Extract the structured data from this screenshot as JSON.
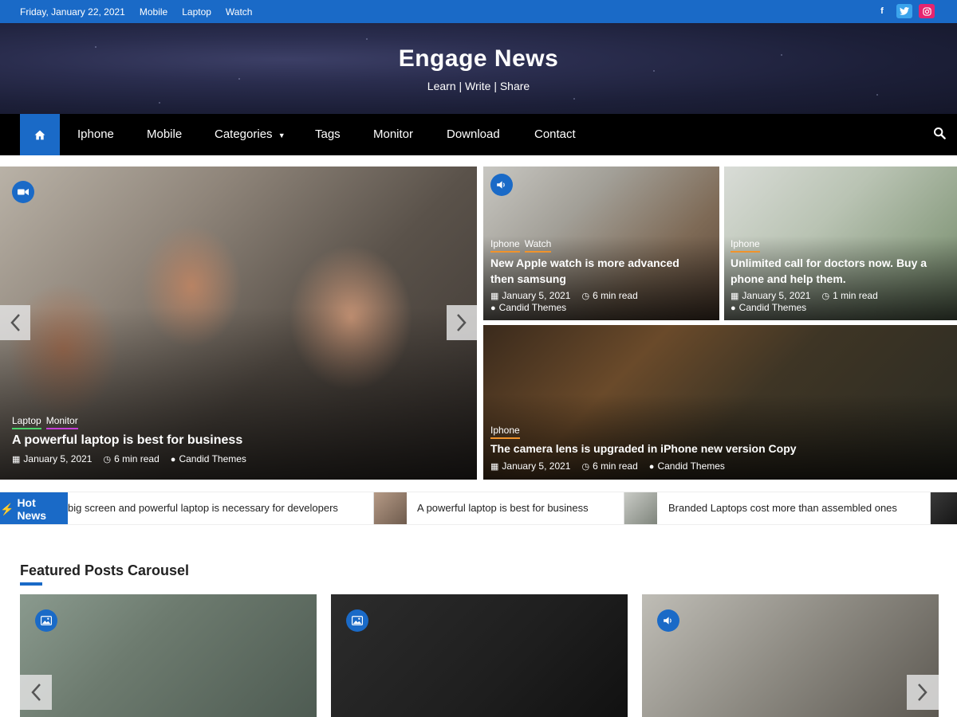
{
  "topbar": {
    "date": "Friday, January 22, 2021",
    "links": [
      "Mobile",
      "Laptop",
      "Watch"
    ],
    "social": [
      "facebook-icon",
      "twitter-icon",
      "instagram-icon"
    ]
  },
  "header": {
    "title": "Engage News",
    "tagline": "Learn | Write | Share"
  },
  "nav": {
    "items": [
      "Iphone",
      "Mobile",
      "Categories",
      "Tags",
      "Monitor",
      "Download",
      "Contact"
    ]
  },
  "slider": {
    "categories": [
      "Laptop",
      "Monitor"
    ],
    "title": "A powerful laptop is best for business",
    "date": "January 5, 2021",
    "read": "6 min read",
    "author": "Candid Themes"
  },
  "cards": [
    {
      "categories": [
        "Iphone",
        "Watch"
      ],
      "title": "New Apple watch is more advanced then samsung",
      "date": "January 5, 2021",
      "read": "6 min read",
      "author": "Candid Themes"
    },
    {
      "categories": [
        "Iphone"
      ],
      "title": "Unlimited call for doctors now. Buy a phone and help them.",
      "date": "January 5, 2021",
      "read": "1 min read",
      "author": "Candid Themes"
    },
    {
      "categories": [
        "Iphone"
      ],
      "title": "The camera lens is upgraded in iPhone new version Copy",
      "date": "January 5, 2021",
      "read": "6 min read",
      "author": "Candid Themes"
    }
  ],
  "hot_news": {
    "label": "Hot News",
    "items": [
      "big screen and powerful laptop is necessary for developers",
      "A powerful laptop is best for business",
      "Branded Laptops cost more than assembled ones"
    ]
  },
  "featured": {
    "title": "Featured Posts Carousel"
  },
  "colors": {
    "accent": "#1a6ac7",
    "nav_bg": "#000000"
  }
}
